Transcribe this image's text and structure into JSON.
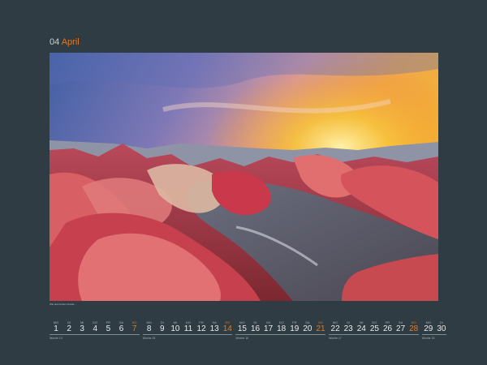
{
  "header": {
    "month_number": "04",
    "month_name": "April"
  },
  "photo": {
    "alt": "Rainbow mountains landscape at sunset"
  },
  "caption": {
    "text": "Wie aus bunten Kreide..."
  },
  "calendar": {
    "days": [
      {
        "dow": "MO",
        "num": "1"
      },
      {
        "dow": "DI",
        "num": "2"
      },
      {
        "dow": "MI",
        "num": "3"
      },
      {
        "dow": "DO",
        "num": "4"
      },
      {
        "dow": "FR",
        "num": "5"
      },
      {
        "dow": "SA",
        "num": "6"
      },
      {
        "dow": "SO",
        "num": "7"
      },
      {
        "dow": "MO",
        "num": "8"
      },
      {
        "dow": "DI",
        "num": "9"
      },
      {
        "dow": "MI",
        "num": "10"
      },
      {
        "dow": "DO",
        "num": "11"
      },
      {
        "dow": "FR",
        "num": "12"
      },
      {
        "dow": "SA",
        "num": "13"
      },
      {
        "dow": "SO",
        "num": "14"
      },
      {
        "dow": "MO",
        "num": "15"
      },
      {
        "dow": "DI",
        "num": "16"
      },
      {
        "dow": "MI",
        "num": "17"
      },
      {
        "dow": "DO",
        "num": "18"
      },
      {
        "dow": "FR",
        "num": "19"
      },
      {
        "dow": "SA",
        "num": "20"
      },
      {
        "dow": "SO",
        "num": "21"
      },
      {
        "dow": "MO",
        "num": "22"
      },
      {
        "dow": "DI",
        "num": "23"
      },
      {
        "dow": "MI",
        "num": "24"
      },
      {
        "dow": "DO",
        "num": "25"
      },
      {
        "dow": "FR",
        "num": "26"
      },
      {
        "dow": "SA",
        "num": "27"
      },
      {
        "dow": "SO",
        "num": "28"
      },
      {
        "dow": "MO",
        "num": "29"
      },
      {
        "dow": "DI",
        "num": "30"
      }
    ],
    "weeks": [
      "Woche 14",
      "Woche 15",
      "Woche 16",
      "Woche 17",
      "Woche 18"
    ]
  },
  "colors": {
    "background": "#2f3c44",
    "accent": "#e07b21",
    "text": "#e8ecee"
  }
}
